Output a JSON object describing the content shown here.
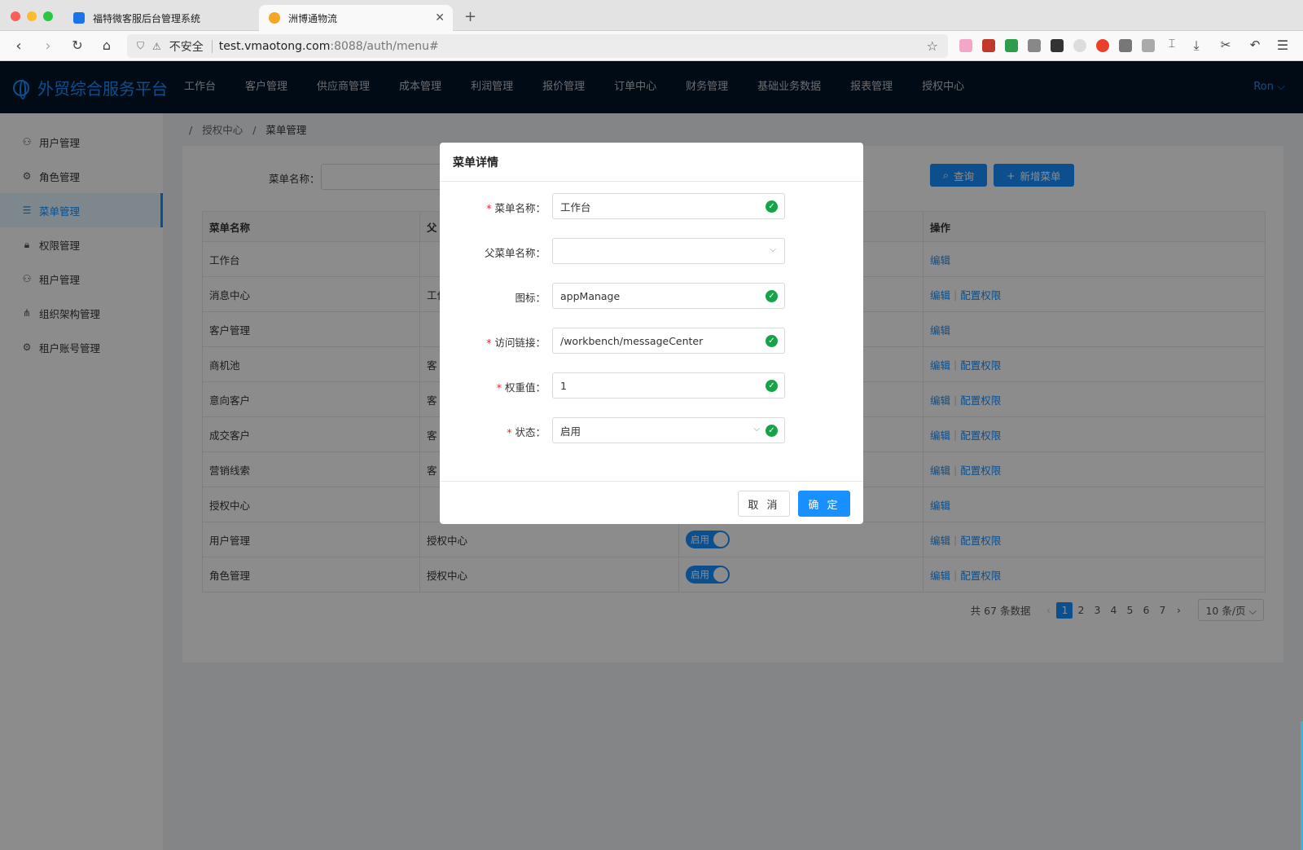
{
  "browser": {
    "tabs": [
      {
        "title": "福特微客服后台管理系统",
        "favicon_color": "#1a73e8"
      },
      {
        "title": "洲博通物流",
        "favicon_color": "#f5a623"
      }
    ],
    "url": {
      "insecure_label": "不安全",
      "host": "test.vmaotong.com",
      "path": ":8088/auth/menu#"
    },
    "icons": [
      "back-icon",
      "forward-icon",
      "reload-icon",
      "home-icon",
      "star-icon",
      "download-icon",
      "menu-icon"
    ]
  },
  "app": {
    "brand": "外贸综合服务平台",
    "nav": [
      "工作台",
      "客户管理",
      "供应商管理",
      "成本管理",
      "利润管理",
      "报价管理",
      "订单中心",
      "财务管理",
      "基础业务数据",
      "报表管理",
      "授权中心"
    ],
    "user": "Ron ⌵",
    "sidebar": [
      {
        "label": "用户管理",
        "icon": "user-icon"
      },
      {
        "label": "角色管理",
        "icon": "role-icon"
      },
      {
        "label": "菜单管理",
        "icon": "menu-list-icon",
        "active": true
      },
      {
        "label": "权限管理",
        "icon": "lock-icon"
      },
      {
        "label": "租户管理",
        "icon": "tenant-icon"
      },
      {
        "label": "组织架构管理",
        "icon": "org-icon"
      },
      {
        "label": "租户账号管理",
        "icon": "account-icon"
      }
    ],
    "breadcrumb": [
      "授权中心",
      "菜单管理"
    ],
    "filter": {
      "label": "菜单名称：",
      "query_btn": "查询",
      "add_btn": "新增菜单"
    },
    "table": {
      "headers": [
        "菜单名称",
        "父",
        "",
        "操作"
      ],
      "rows": [
        {
          "name": "工作台",
          "parent": "",
          "status": "",
          "ops": [
            "编辑"
          ]
        },
        {
          "name": "消息中心",
          "parent": "工作",
          "status": "",
          "ops": [
            "编辑",
            "配置权限"
          ]
        },
        {
          "name": "客户管理",
          "parent": "",
          "status": "",
          "ops": [
            "编辑"
          ]
        },
        {
          "name": "商机池",
          "parent": "客",
          "status": "",
          "ops": [
            "编辑",
            "配置权限"
          ]
        },
        {
          "name": "意向客户",
          "parent": "客",
          "status": "",
          "ops": [
            "编辑",
            "配置权限"
          ]
        },
        {
          "name": "成交客户",
          "parent": "客",
          "status": "",
          "ops": [
            "编辑",
            "配置权限"
          ]
        },
        {
          "name": "营销线索",
          "parent": "客",
          "status": "",
          "ops": [
            "编辑",
            "配置权限"
          ]
        },
        {
          "name": "授权中心",
          "parent": "",
          "status": "",
          "ops": [
            "编辑"
          ]
        },
        {
          "name": "用户管理",
          "parent": "授权中心",
          "status": "启用",
          "ops": [
            "编辑",
            "配置权限"
          ]
        },
        {
          "name": "角色管理",
          "parent": "授权中心",
          "status": "启用",
          "ops": [
            "编辑",
            "配置权限"
          ]
        }
      ]
    },
    "pagination": {
      "total": "共 67 条数据",
      "pages": [
        "1",
        "2",
        "3",
        "4",
        "5",
        "6",
        "7"
      ],
      "current": "1",
      "page_size": "10 条/页 ⌵",
      "prev": "‹",
      "next": "›"
    }
  },
  "modal": {
    "title": "菜单详情",
    "fields": [
      {
        "label": "菜单名称：",
        "required": true,
        "value": "工作台",
        "type": "input",
        "valid": true
      },
      {
        "label": "父菜单名称：",
        "required": false,
        "value": "",
        "type": "select",
        "valid": false
      },
      {
        "label": "图标：",
        "required": false,
        "value": "appManage",
        "type": "input",
        "valid": true
      },
      {
        "label": "访问链接：",
        "required": true,
        "value": "/workbench/messageCenter",
        "type": "input",
        "valid": true
      },
      {
        "label": "权重值：",
        "required": true,
        "value": "1",
        "type": "input",
        "valid": true
      },
      {
        "label": "状态：",
        "required": true,
        "value": "启用",
        "type": "select",
        "valid": true
      }
    ],
    "cancel": "取 消",
    "ok": "确 定"
  },
  "colors": {
    "primary": "#1890ff",
    "success": "#16a34a",
    "nav_bg": "#001529"
  }
}
